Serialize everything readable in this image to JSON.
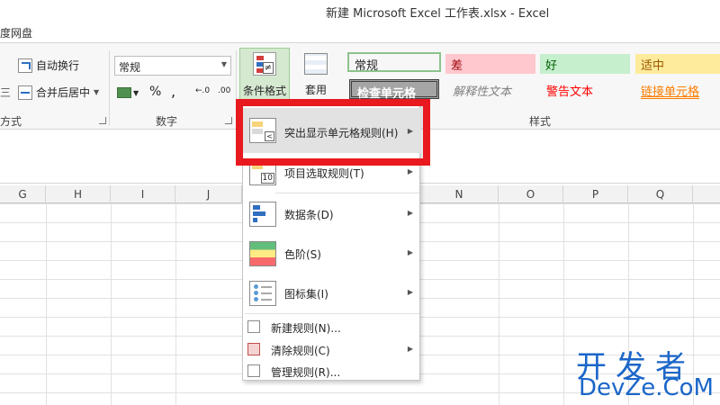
{
  "window": {
    "title": "新建 Microsoft Excel 工作表.xlsx - Excel"
  },
  "tabs": {
    "baidu": "度网盘"
  },
  "ribbon": {
    "alignment": {
      "wrap_text": "自动换行",
      "merge_center": "合并后居中",
      "group_label": "方式"
    },
    "number": {
      "format_value": "常规",
      "percent": "%",
      "comma": ",",
      "inc_decimal": "←.0",
      "dec_decimal": ".00",
      "group_label": "数字"
    },
    "conditional_formatting": "条件格式",
    "format_as_table": "套用",
    "styles": {
      "group_label": "样式",
      "cells": [
        {
          "label": "常规",
          "bg": "#ffffff",
          "color": "#000000"
        },
        {
          "label": "差",
          "bg": "#ffc7ce",
          "color": "#9c0006"
        },
        {
          "label": "好",
          "bg": "#c6efce",
          "color": "#006100"
        },
        {
          "label": "适中",
          "bg": "#ffeb9c",
          "color": "#9c5700"
        },
        {
          "label": "检查单元格",
          "bg": "#a5a5a5",
          "color": "#ffffff"
        },
        {
          "label": "解释性文本",
          "bg": "#ffffff",
          "color": "#7f7f7f"
        },
        {
          "label": "警告文本",
          "bg": "#ffffff",
          "color": "#ff0000"
        },
        {
          "label": "链接单元格",
          "bg": "#ffffff",
          "color": "#fa7d00"
        }
      ]
    }
  },
  "columns": [
    "G",
    "H",
    "I",
    "J",
    "N",
    "O",
    "P",
    "Q"
  ],
  "menu": {
    "highlight_rules": "突出显示单元格规则(H)",
    "top_bottom_rules": "项目选取规则(T)",
    "data_bars": "数据条(D)",
    "color_scales": "色阶(S)",
    "icon_sets": "图标集(I)",
    "new_rule": "新建规则(N)...",
    "clear_rules": "清除规则(C)",
    "manage_rules": "管理规则(R)..."
  },
  "watermark": {
    "cn": "开发者",
    "en": "DevZe.CoM"
  },
  "accent": {
    "annotation_red": "#e8191f",
    "selected_green": "#d5e8d0"
  }
}
